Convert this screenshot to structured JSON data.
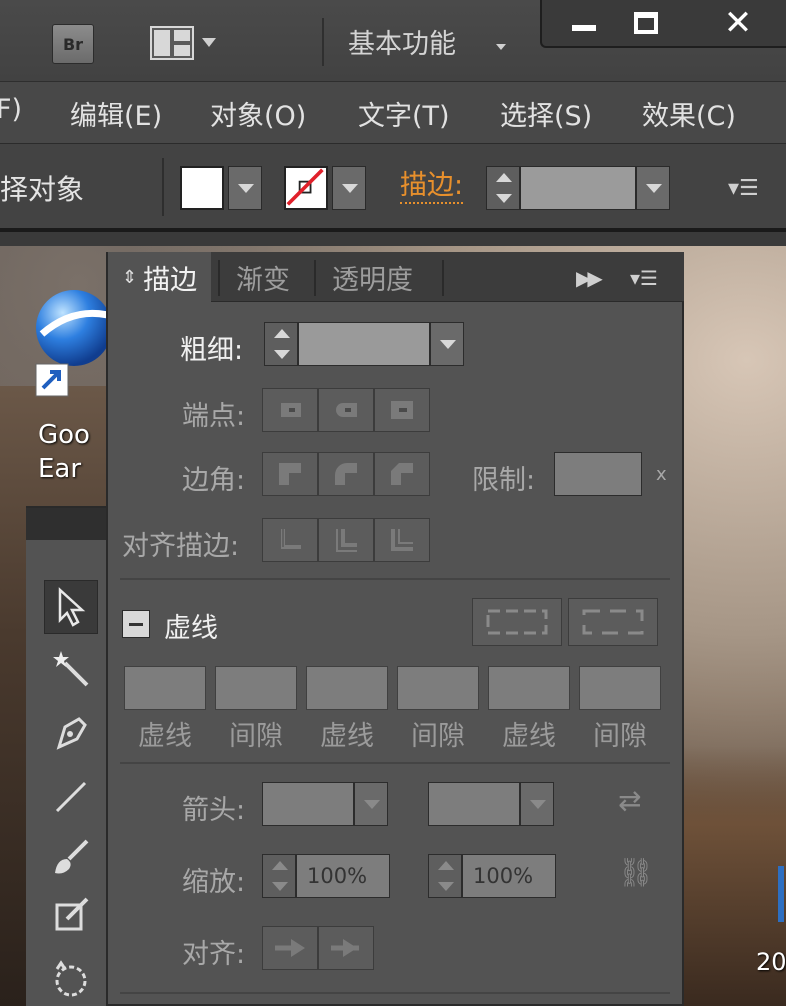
{
  "titlebar": {
    "bridge_label": "Br",
    "workspace_label": "基本功能",
    "close_glyph": "✕"
  },
  "menu": {
    "items": [
      {
        "label": "F)"
      },
      {
        "label": "编辑(E)"
      },
      {
        "label": "对象(O)"
      },
      {
        "label": "文字(T)"
      },
      {
        "label": "选择(S)"
      },
      {
        "label": "效果(C)"
      }
    ]
  },
  "controlbar": {
    "selection_label": "择对象",
    "stroke_link_label": "描边:",
    "fill_color": "#ffffff",
    "stroke_color": "none",
    "stroke_weight_value": ""
  },
  "desktop": {
    "icon_label_line1": "Goo",
    "icon_label_line2": "Ear",
    "bottom_right_text": "20"
  },
  "stroke_panel": {
    "tabs": [
      {
        "label": "描边",
        "active": true
      },
      {
        "label": "渐变",
        "active": false
      },
      {
        "label": "透明度",
        "active": false
      }
    ],
    "weight_label": "粗细:",
    "weight_value": "",
    "cap_label": "端点:",
    "corner_label": "边角:",
    "limit_label": "限制:",
    "limit_value": "",
    "limit_suffix": "x",
    "align_stroke_label": "对齐描边:",
    "dashed_label": "虚线",
    "dashed_checked": false,
    "dash_fields": [
      {
        "label": "虚线",
        "value": ""
      },
      {
        "label": "间隙",
        "value": ""
      },
      {
        "label": "虚线",
        "value": ""
      },
      {
        "label": "间隙",
        "value": ""
      },
      {
        "label": "虚线",
        "value": ""
      },
      {
        "label": "间隙",
        "value": ""
      }
    ],
    "arrowhead_label": "箭头:",
    "scale_label": "缩放:",
    "scale_start": "100%",
    "scale_end": "100%",
    "align_label": "对齐:"
  },
  "colors": {
    "accent_orange": "#e8902c",
    "panel_bg": "#535353",
    "none_slash": "#e0202a"
  }
}
